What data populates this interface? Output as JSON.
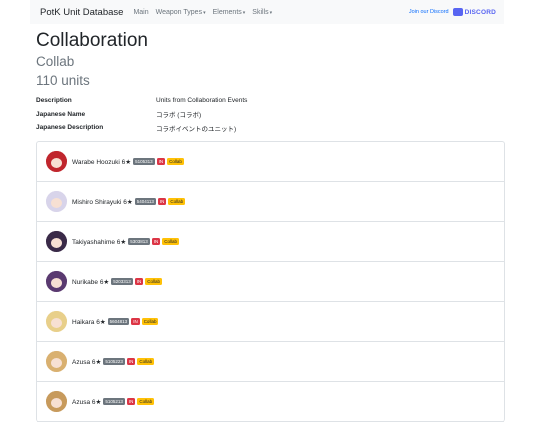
{
  "nav": {
    "brand": "PotK Unit Database",
    "links": [
      {
        "label": "Main",
        "dropdown": false
      },
      {
        "label": "Weapon Types",
        "dropdown": true
      },
      {
        "label": "Elements",
        "dropdown": true
      },
      {
        "label": "Skills",
        "dropdown": true
      }
    ],
    "join_text": "Join our Discord",
    "discord_label": "DISCORD",
    "caret": "▾"
  },
  "page": {
    "title": "Collaboration",
    "subtitle": "Collab",
    "count": "110 units"
  },
  "info": [
    {
      "key": "Description",
      "value": "Units from Collaboration Events"
    },
    {
      "key": "Japanese Name",
      "value": "コラボ (コラボ)"
    },
    {
      "key": "Japanese Description",
      "value": "コラボイベントのユニット)"
    }
  ],
  "units": [
    {
      "name": "Warabe Hoozuki 6★",
      "id": "5105313",
      "tag": "IN",
      "group": "Collab",
      "hair_color": "#c0262d"
    },
    {
      "name": "Mishiro Shirayuki 6★",
      "id": "5404113",
      "tag": "IN",
      "group": "Collab",
      "hair_color": "#d8d4ea"
    },
    {
      "name": "Takiyashahime 6★",
      "id": "5303813",
      "tag": "IN",
      "group": "Collab",
      "hair_color": "#3a2a48"
    },
    {
      "name": "Nurikabe 6★",
      "id": "5203313",
      "tag": "IN",
      "group": "Collab",
      "hair_color": "#5a3a70"
    },
    {
      "name": "Haikara 6★",
      "id": "5604813",
      "tag": "IN",
      "group": "Collab",
      "hair_color": "#e8cf8a"
    },
    {
      "name": "Azusa 6★",
      "id": "5105223",
      "tag": "IN",
      "group": "Collab",
      "hair_color": "#d9b070"
    },
    {
      "name": "Azusa 6★",
      "id": "5105213",
      "tag": "IN",
      "group": "Collab",
      "hair_color": "#c79a5c"
    }
  ]
}
